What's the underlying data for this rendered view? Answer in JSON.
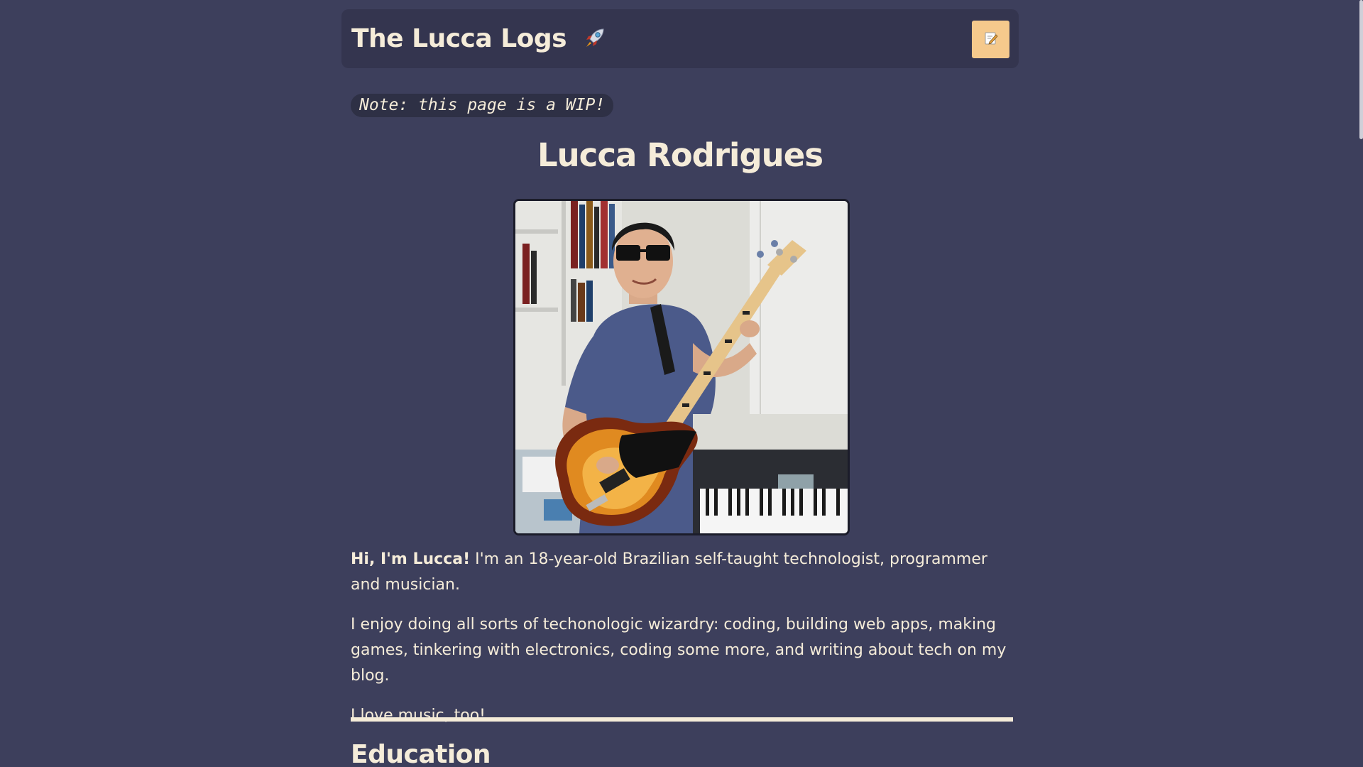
{
  "header": {
    "title": "The Lucca Logs",
    "title_icon": "rocket-icon",
    "edit_icon": "memo-icon"
  },
  "note": "Note: this page is a WIP!",
  "profile": {
    "name": "Lucca Rodrigues",
    "photo_icon": "profile-photo"
  },
  "intro": {
    "greeting": "Hi, I'm Lucca!",
    "p1": " I'm an 18-year-old Brazilian self-taught technologist, programmer and musician.",
    "p2": "I enjoy doing all sorts of techonologic wizardry: coding, building web apps, making games, tinkering with electronics, coding some more, and writing about tech on my blog.",
    "p3": "I love music, too!"
  },
  "sections": {
    "education": "Education"
  },
  "colors": {
    "background": "#3d3f5c",
    "header_bg": "#34354f",
    "accent": "#f5c98c",
    "text": "#f5ecd9"
  }
}
